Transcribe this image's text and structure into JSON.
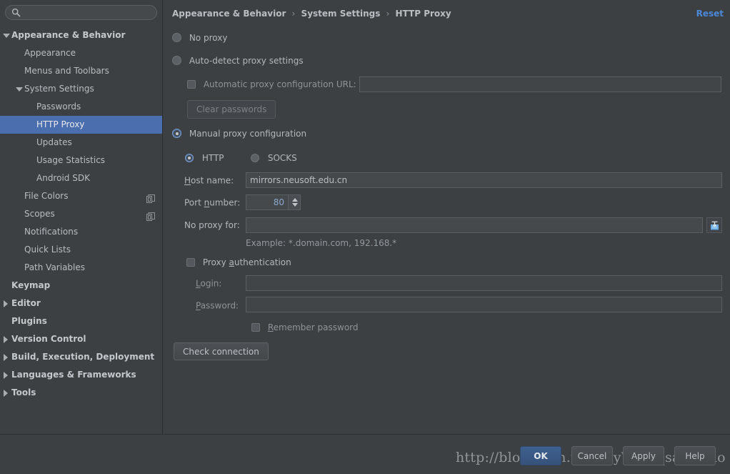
{
  "sidebar": {
    "search": {
      "value": "",
      "placeholder": "",
      "icon": "search-icon"
    },
    "items": [
      {
        "label": "Appearance & Behavior",
        "indent": 16,
        "arrow": "down",
        "bold": true,
        "selected": false,
        "badge": false
      },
      {
        "label": "Appearance",
        "indent": 34,
        "arrow": "none",
        "bold": false,
        "selected": false,
        "badge": false
      },
      {
        "label": "Menus and Toolbars",
        "indent": 34,
        "arrow": "none",
        "bold": false,
        "selected": false,
        "badge": false
      },
      {
        "label": "System Settings",
        "indent": 34,
        "arrow": "down",
        "bold": false,
        "selected": false,
        "badge": false
      },
      {
        "label": "Passwords",
        "indent": 51,
        "arrow": "none",
        "bold": false,
        "selected": false,
        "badge": false
      },
      {
        "label": "HTTP Proxy",
        "indent": 51,
        "arrow": "none",
        "bold": false,
        "selected": true,
        "badge": false
      },
      {
        "label": "Updates",
        "indent": 51,
        "arrow": "none",
        "bold": false,
        "selected": false,
        "badge": false
      },
      {
        "label": "Usage Statistics",
        "indent": 51,
        "arrow": "none",
        "bold": false,
        "selected": false,
        "badge": false
      },
      {
        "label": "Android SDK",
        "indent": 51,
        "arrow": "none",
        "bold": false,
        "selected": false,
        "badge": false
      },
      {
        "label": "File Colors",
        "indent": 34,
        "arrow": "none",
        "bold": false,
        "selected": false,
        "badge": true
      },
      {
        "label": "Scopes",
        "indent": 34,
        "arrow": "none",
        "bold": false,
        "selected": false,
        "badge": true
      },
      {
        "label": "Notifications",
        "indent": 34,
        "arrow": "none",
        "bold": false,
        "selected": false,
        "badge": false
      },
      {
        "label": "Quick Lists",
        "indent": 34,
        "arrow": "none",
        "bold": false,
        "selected": false,
        "badge": false
      },
      {
        "label": "Path Variables",
        "indent": 34,
        "arrow": "none",
        "bold": false,
        "selected": false,
        "badge": false
      },
      {
        "label": "Keymap",
        "indent": 16,
        "arrow": "none",
        "bold": true,
        "selected": false,
        "badge": false
      },
      {
        "label": "Editor",
        "indent": 16,
        "arrow": "right",
        "bold": true,
        "selected": false,
        "badge": false
      },
      {
        "label": "Plugins",
        "indent": 16,
        "arrow": "none",
        "bold": true,
        "selected": false,
        "badge": false
      },
      {
        "label": "Version Control",
        "indent": 16,
        "arrow": "right",
        "bold": true,
        "selected": false,
        "badge": false
      },
      {
        "label": "Build, Execution, Deployment",
        "indent": 16,
        "arrow": "right",
        "bold": true,
        "selected": false,
        "badge": false
      },
      {
        "label": "Languages & Frameworks",
        "indent": 16,
        "arrow": "right",
        "bold": true,
        "selected": false,
        "badge": false
      },
      {
        "label": "Tools",
        "indent": 16,
        "arrow": "right",
        "bold": true,
        "selected": false,
        "badge": false
      }
    ]
  },
  "header": {
    "breadcrumb": [
      "Appearance & Behavior",
      "System Settings",
      "HTTP Proxy"
    ],
    "separator": "›",
    "reset_label": "Reset",
    "reset_color": "#4a88d8"
  },
  "proxy": {
    "mode_selected": "manual",
    "no_proxy_label": "No proxy",
    "auto_detect_label": "Auto-detect proxy settings",
    "auto_url_checkbox_label": "Automatic proxy configuration URL:",
    "auto_url_checked": false,
    "auto_url_value": "",
    "clear_passwords_label": "Clear passwords",
    "clear_passwords_enabled": false,
    "manual_label": "Manual proxy configuration",
    "protocol_selected": "HTTP",
    "http_label": "HTTP",
    "socks_label": "SOCKS",
    "host_label": "Host name:",
    "host_value": "mirrors.neusoft.edu.cn",
    "port_label": "Port number:",
    "port_value": "80",
    "no_proxy_for_label": "No proxy for:",
    "no_proxy_for_value": "",
    "expand_icon": "expand-field-icon",
    "example_text": "Example: *.domain.com, 192.168.*",
    "proxy_auth_label": "Proxy authentication",
    "proxy_auth_checked": false,
    "login_label": "Login:",
    "login_value": "",
    "password_label": "Password:",
    "password_value": "",
    "remember_label": "Remember password",
    "remember_checked": false,
    "check_connection_label": "Check connection"
  },
  "footer": {
    "ok_label": "OK",
    "cancel_label": "Cancel",
    "apply_label": "Apply",
    "help_label": "Help",
    "default_button": "OK",
    "watermark": "http://blog.csdn.net/sayWhat_sayHello"
  },
  "theme": {
    "background": "#3c4043",
    "field_background": "#45494c",
    "selection": "#4b6eaf",
    "text": "#b2b7bc",
    "accent": "#4a88d8"
  }
}
